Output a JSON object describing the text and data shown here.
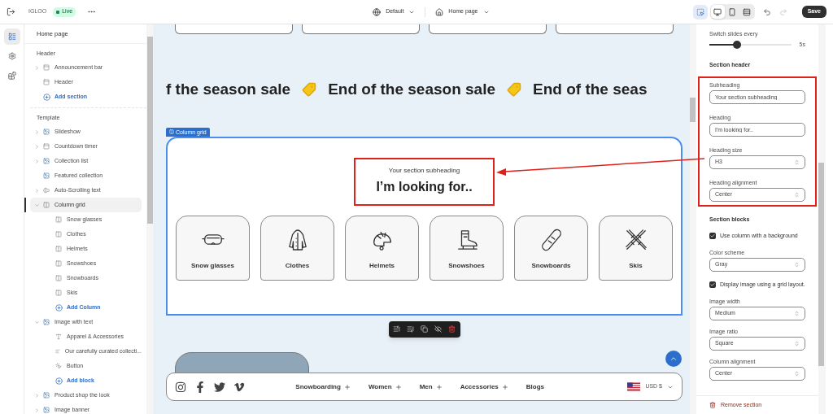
{
  "topbar": {
    "store_name": "IGLOO",
    "status": "Live",
    "theme": "Default",
    "page": "Home page",
    "inspect_active": true,
    "views": [
      {
        "kind": "desktop",
        "selected": true
      },
      {
        "kind": "mobile",
        "selected": false
      },
      {
        "kind": "full",
        "selected": false
      }
    ],
    "redo_disabled": true,
    "save": "Save"
  },
  "rail": [
    {
      "kind": "sections",
      "selected": true
    },
    {
      "kind": "settings",
      "selected": false
    },
    {
      "kind": "apps",
      "selected": false
    }
  ],
  "sidebar": {
    "title": "Home page",
    "groups": [
      {
        "title": "Header",
        "add": "Add section",
        "items": [
          {
            "label": "Announcement bar",
            "kind": "section",
            "expanded": false,
            "selected": false
          },
          {
            "label": "Header",
            "kind": "section",
            "selected": false
          }
        ]
      },
      {
        "title": "Template",
        "items": [
          {
            "label": "Slideshow",
            "kind": "image",
            "expanded": false,
            "selected": false
          },
          {
            "label": "Countdown timer",
            "kind": "section",
            "expanded": false,
            "selected": false
          },
          {
            "label": "Collection list",
            "kind": "image",
            "expanded": false,
            "selected": false
          },
          {
            "label": "Featured collection",
            "kind": "image",
            "selected": false
          },
          {
            "label": "Auto-Scrolling text",
            "kind": "textbox",
            "expanded": false,
            "selected": false
          },
          {
            "label": "Column grid",
            "kind": "column",
            "expanded": true,
            "selected": true,
            "add": "Add Column",
            "children": [
              {
                "label": "Snow glasses",
                "kind": "column",
                "selected": false
              },
              {
                "label": "Clothes",
                "kind": "column",
                "selected": false
              },
              {
                "label": "Helmets",
                "kind": "column",
                "selected": false
              },
              {
                "label": "Snowshoes",
                "kind": "column",
                "selected": false
              },
              {
                "label": "Snowboards",
                "kind": "column",
                "selected": false
              },
              {
                "label": "Skis",
                "kind": "column",
                "selected": false
              }
            ]
          },
          {
            "label": "Image with text",
            "kind": "image",
            "expanded": true,
            "selected": false,
            "add": "Add block",
            "children": [
              {
                "label": "Apparel & Accessories",
                "kind": "text",
                "selected": false
              },
              {
                "label": "Our carefully curated collecti...",
                "kind": "paragraph",
                "selected": false
              },
              {
                "label": "Button",
                "kind": "button",
                "selected": false
              }
            ]
          },
          {
            "label": "Product shop the look",
            "kind": "image",
            "expanded": false,
            "selected": false
          },
          {
            "label": "Image banner",
            "kind": "image",
            "expanded": false,
            "selected": false
          }
        ]
      }
    ]
  },
  "canvas": {
    "marquee": [
      "f the season sale",
      "End of the season sale",
      "End of the seas"
    ],
    "section_tag": "Column grid",
    "subheading": "Your section subheading",
    "heading": "I’m looking for..",
    "columns": [
      {
        "label": "Snow glasses",
        "kind": "goggles"
      },
      {
        "label": "Clothes",
        "kind": "coat"
      },
      {
        "label": "Helmets",
        "kind": "helmet"
      },
      {
        "label": "Snowshoes",
        "kind": "boot"
      },
      {
        "label": "Snowboards",
        "kind": "snowboard"
      },
      {
        "label": "Skis",
        "kind": "skis"
      }
    ],
    "footer": {
      "social": [
        {
          "kind": "instagram"
        },
        {
          "kind": "facebook"
        },
        {
          "kind": "twitter"
        },
        {
          "kind": "vimeo"
        }
      ],
      "nav": [
        {
          "label": "Snowboarding",
          "kind": "dropdown"
        },
        {
          "label": "Women",
          "kind": "dropdown"
        },
        {
          "label": "Men",
          "kind": "dropdown"
        },
        {
          "label": "Accessories",
          "kind": "dropdown"
        },
        {
          "label": "Blogs",
          "kind": "link"
        }
      ],
      "currency": "USD $"
    }
  },
  "settings": {
    "slider": {
      "label": "Switch slides every",
      "level": 0.34,
      "reading": "5s"
    },
    "section_header": {
      "title": "Section header",
      "fields": [
        {
          "kind": "text",
          "label": "Subheading",
          "value": "Your section subheading"
        },
        {
          "kind": "text",
          "label": "Heading",
          "value": "I'm looking for.."
        },
        {
          "kind": "select",
          "label": "Heading size",
          "value": "H3"
        },
        {
          "kind": "select",
          "label": "Heading alignment",
          "value": "Center"
        }
      ]
    },
    "section_blocks": {
      "title": "Section blocks",
      "fields": [
        {
          "kind": "checkbox",
          "label": "Use column with a background",
          "checked": true
        },
        {
          "kind": "select",
          "label": "Color scheme",
          "value": "Gray"
        },
        {
          "kind": "checkbox",
          "label": "Display image using a grid layout.",
          "checked": true
        },
        {
          "kind": "select",
          "label": "Image width",
          "value": "Medium"
        },
        {
          "kind": "select",
          "label": "Image ratio",
          "value": "Square"
        },
        {
          "kind": "select",
          "label": "Column alignment",
          "value": "Center"
        }
      ]
    },
    "remove": "Remove section"
  }
}
